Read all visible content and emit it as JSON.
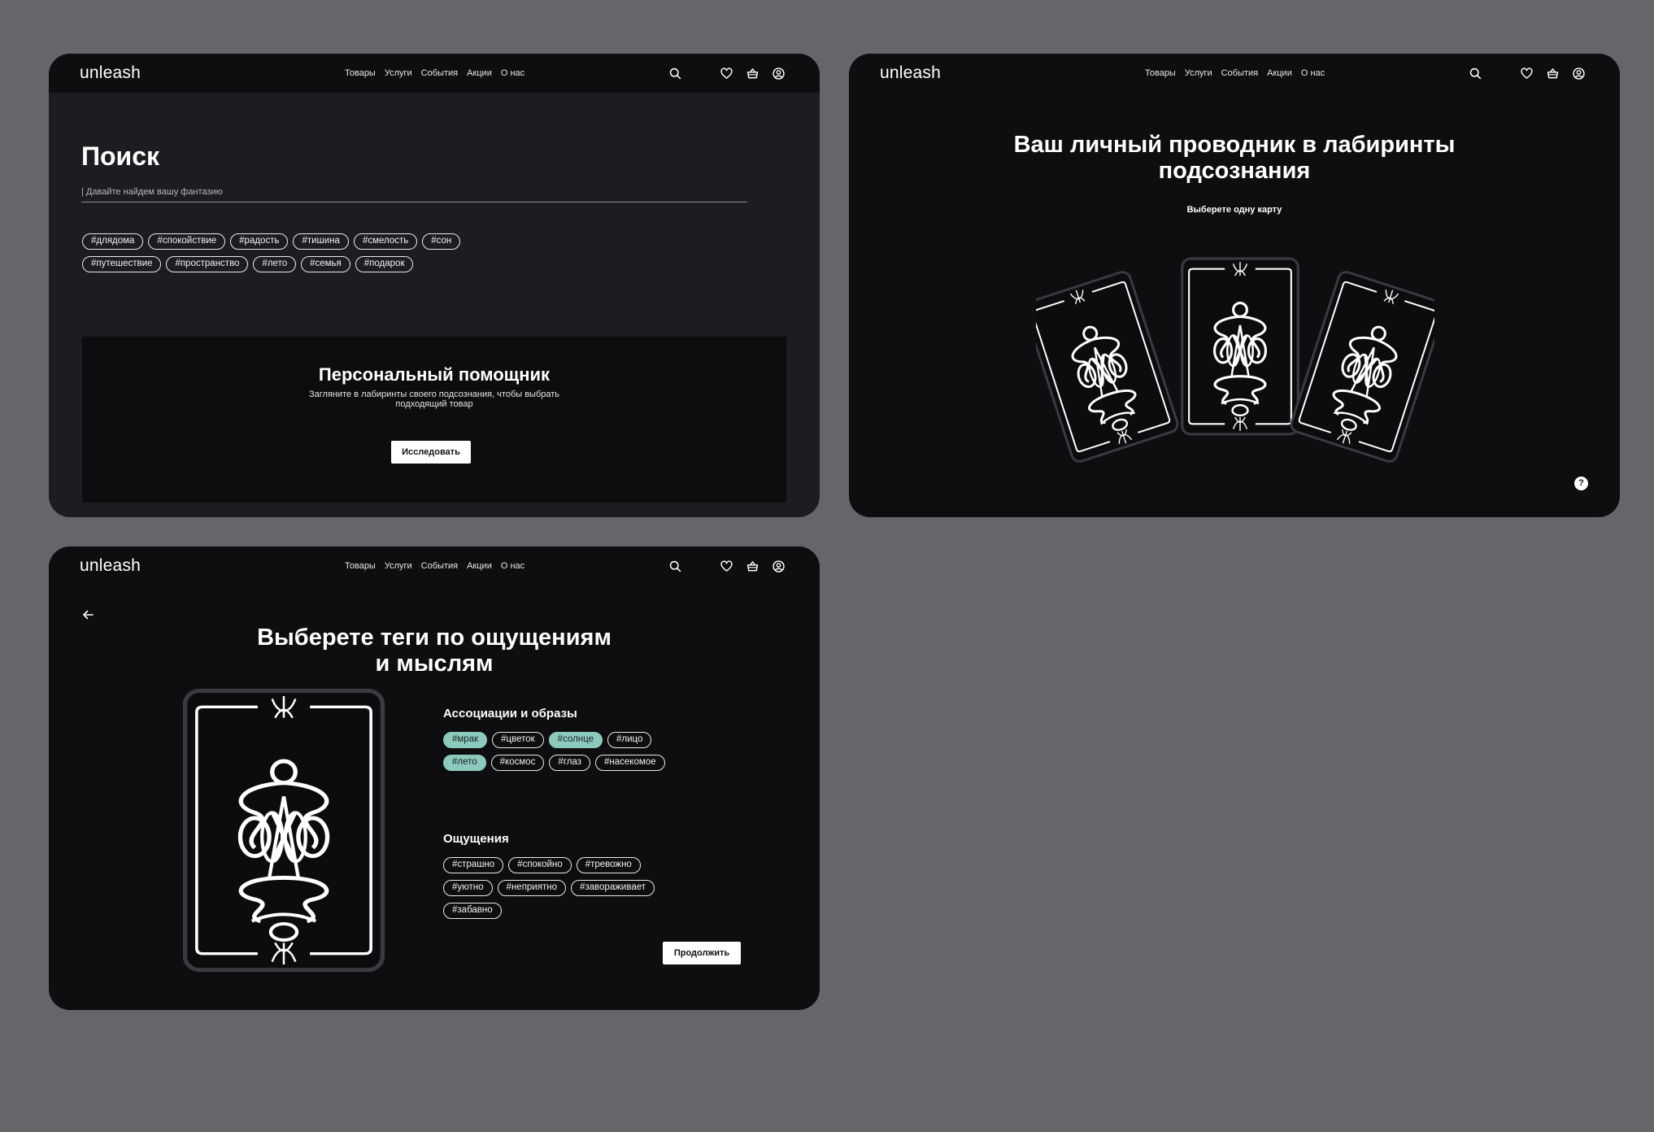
{
  "brand": "unleash",
  "nav": {
    "menu": [
      "Товары",
      "Услуги",
      "События",
      "Акции",
      "О нас"
    ],
    "icons": [
      "search-icon",
      "heart-icon",
      "basket-icon",
      "user-icon"
    ]
  },
  "search_screen": {
    "title": "Поиск",
    "search_placeholder": "| Давайте найдем вашу фантазию",
    "tags_row1": [
      "#длядома",
      "#спокойствие",
      "#радость",
      "#тишина",
      "#смелость",
      "#сон"
    ],
    "tags_row2": [
      "#путешествие",
      "#пространство",
      "#лето",
      "#семья",
      "#подарок"
    ],
    "promo": {
      "title": "Персональный помощник",
      "text_line1": "Загляните в лабиринты своего подсознания, чтобы выбрать",
      "text_line2": "подходящий товар",
      "button": "Исследовать"
    }
  },
  "cards_screen": {
    "title_line1": "Ваш личный проводник в лабиринты",
    "title_line2": "подсознания",
    "subtitle": "Выберете одну карту",
    "help_label": "?"
  },
  "tags_screen": {
    "title_line1": "Выберете теги по ощущениям",
    "title_line2": "и мыслям",
    "assoc_heading": "Ассоциации и образы",
    "assoc_row1": [
      {
        "label": "#мрак",
        "selected": true
      },
      {
        "label": "#цветок",
        "selected": false
      },
      {
        "label": "#солнце",
        "selected": true
      },
      {
        "label": "#лицо",
        "selected": false
      }
    ],
    "assoc_row2": [
      {
        "label": "#лето",
        "selected": true
      },
      {
        "label": "#космос",
        "selected": false
      },
      {
        "label": "#глаз",
        "selected": false
      },
      {
        "label": "#насекомое",
        "selected": false
      }
    ],
    "feel_heading": "Ощущения",
    "feel_row1": [
      {
        "label": "#страшно",
        "selected": false
      },
      {
        "label": "#спокойно",
        "selected": false
      },
      {
        "label": "#тревожно",
        "selected": false
      }
    ],
    "feel_row2": [
      {
        "label": "#уютно",
        "selected": false
      },
      {
        "label": "#неприятно",
        "selected": false
      },
      {
        "label": "#завораживает",
        "selected": false
      }
    ],
    "feel_row3": [
      {
        "label": "#забавно",
        "selected": false
      }
    ],
    "continue_button": "Продолжить"
  },
  "colors": {
    "page_bg": "#65666a",
    "frame_dark": "#0e0e11",
    "search_bg": "#1b1d21",
    "selected_tag": "#8ec9bd"
  }
}
